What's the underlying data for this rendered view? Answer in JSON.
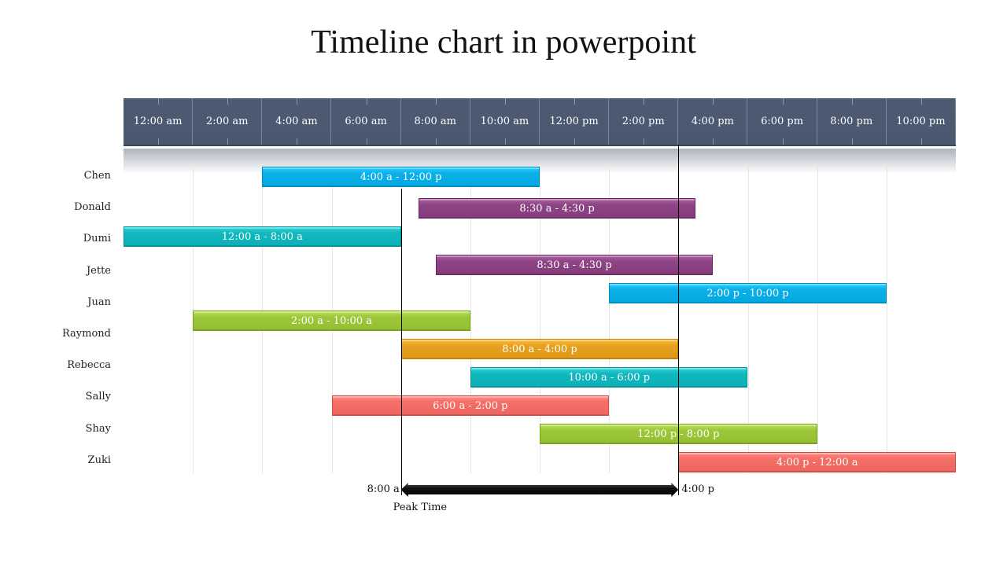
{
  "chart_data": {
    "type": "gantt",
    "title": "Timeline chart in powerpoint",
    "xlabel": "",
    "ylabel": "",
    "x_range_hours": [
      0,
      24
    ],
    "tick_labels": [
      "12:00 am",
      "2:00 am",
      "4:00 am",
      "6:00 am",
      "8:00 am",
      "10:00 am",
      "12:00 pm",
      "2:00 pm",
      "4:00 pm",
      "6:00 pm",
      "8:00 pm",
      "10:00 pm"
    ],
    "names": [
      "Chen",
      "Donald",
      "Dumi",
      "Jette",
      "Juan",
      "Raymond",
      "Rebecca",
      "Sally",
      "Shay",
      "Zuki"
    ],
    "bars": [
      {
        "label": "4:00 a - 12:00 p",
        "start": 4,
        "end": 12,
        "color": "#0bb0e8"
      },
      {
        "label": "8:30 a - 4:30 p",
        "start": 8.5,
        "end": 16.5,
        "color": "#8e4585"
      },
      {
        "label": "12:00 a - 8:00 a",
        "start": 0,
        "end": 8,
        "color": "#13b8be"
      },
      {
        "label": "8:30 a - 4:30 p",
        "start": 9,
        "end": 17,
        "color": "#8e4585"
      },
      {
        "label": "2:00 p - 10:00 p",
        "start": 14,
        "end": 22,
        "color": "#0bb0e8"
      },
      {
        "label": "2:00 a - 10:00 a",
        "start": 2,
        "end": 10,
        "color": "#9dc73a"
      },
      {
        "label": "8:00 a - 4:00 p",
        "start": 8,
        "end": 16,
        "color": "#e6a11f"
      },
      {
        "label": "10:00 a - 6:00 p",
        "start": 10,
        "end": 18,
        "color": "#13b8be"
      },
      {
        "label": "6:00 a - 2:00 p",
        "start": 6,
        "end": 14,
        "color": "#f56e68"
      },
      {
        "label": "12:00 p - 8:00 p",
        "start": 12,
        "end": 20,
        "color": "#9dc73a"
      },
      {
        "label": "4:00 p - 12:00 a",
        "start": 16,
        "end": 24,
        "color": "#f56e68"
      }
    ],
    "peak": {
      "start": 8,
      "end": 16,
      "start_label": "8:00 a",
      "end_label": "4:00 p",
      "caption": "Peak Time"
    }
  }
}
